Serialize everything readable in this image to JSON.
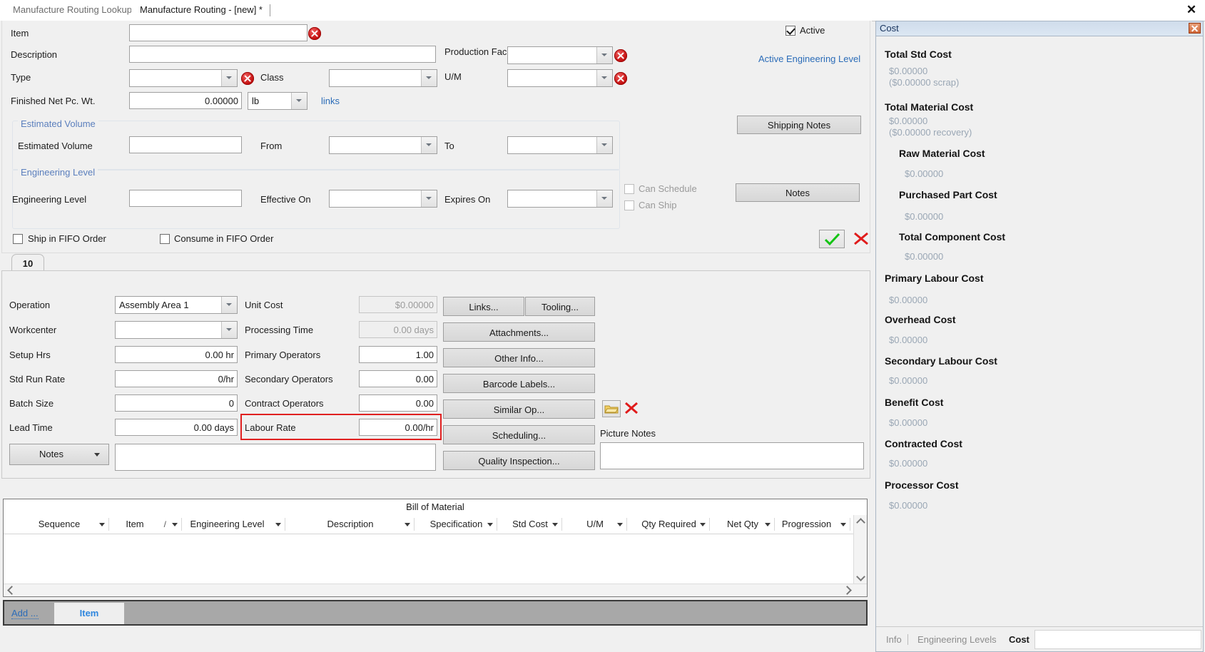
{
  "window": {
    "close_label": "✕"
  },
  "tabs": {
    "inactive": "Manufacture Routing Lookup",
    "active": "Manufacture Routing - [new] *"
  },
  "header": {
    "item_label": "Item",
    "item_value": "",
    "description_label": "Description",
    "description_value": "",
    "type_label": "Type",
    "type_value": "",
    "class_label": "Class",
    "class_value": "",
    "finished_net_label": "Finished Net Pc. Wt.",
    "finished_net_value": "0.00000",
    "uom_weight_value": "lb",
    "links_label": "links",
    "production_facility_label": "Production Facility",
    "production_facility_value": "",
    "um_label": "U/M",
    "um_value": "",
    "active_label": "Active",
    "active_engineering_level_label": "Active Engineering Level",
    "shipping_notes_label": "Shipping Notes",
    "notes_label": "Notes"
  },
  "estimated_volume": {
    "group_title": "Estimated Volume",
    "field_label": "Estimated Volume",
    "field_value": "",
    "from_label": "From",
    "from_value": "",
    "to_label": "To",
    "to_value": ""
  },
  "engineering_level": {
    "group_title": "Engineering Level",
    "field_label": "Engineering Level",
    "field_value": "",
    "effective_on_label": "Effective On",
    "effective_on_value": "",
    "expires_on_label": "Expires On",
    "expires_on_value": "",
    "can_schedule_label": "Can Schedule",
    "can_ship_label": "Can Ship"
  },
  "fifo": {
    "ship_label": "Ship in FIFO Order",
    "consume_label": "Consume in FIFO Order"
  },
  "operation": {
    "tab_label": "10",
    "operation_label": "Operation",
    "operation_value": "Assembly Area 1",
    "workcenter_label": "Workcenter",
    "workcenter_value": "",
    "setup_hrs_label": "Setup Hrs",
    "setup_hrs_value": "0.00 hr",
    "std_run_rate_label": "Std Run Rate",
    "std_run_rate_value": "0/hr",
    "batch_size_label": "Batch Size",
    "batch_size_value": "0",
    "lead_time_label": "Lead Time",
    "lead_time_value": "0.00 days",
    "unit_cost_label": "Unit Cost",
    "unit_cost_value": "$0.00000",
    "processing_time_label": "Processing Time",
    "processing_time_value": "0.00 days",
    "primary_operators_label": "Primary Operators",
    "primary_operators_value": "1.00",
    "secondary_operators_label": "Secondary Operators",
    "secondary_operators_value": "0.00",
    "contract_operators_label": "Contract Operators",
    "contract_operators_value": "0.00",
    "labour_rate_label": "Labour Rate",
    "labour_rate_value": "0.00/hr",
    "notes_label": "Notes",
    "notes_value": "",
    "picture_notes_label": "Picture Notes",
    "picture_notes_value": "",
    "buttons": {
      "links": "Links...",
      "tooling": "Tooling...",
      "attachments": "Attachments...",
      "other_info": "Other Info...",
      "barcode_labels": "Barcode Labels...",
      "similar_op": "Similar Op...",
      "scheduling": "Scheduling...",
      "quality_inspection": "Quality Inspection..."
    }
  },
  "bom": {
    "title": "Bill of Material",
    "columns": [
      "Sequence",
      "Item",
      "Engineering Level",
      "Description",
      "Specification",
      "Std Cost",
      "U/M",
      "Qty Required",
      "Net Qty",
      "Progression"
    ],
    "rows": []
  },
  "statusbar": {
    "add_label": "Add ...",
    "item_label": "Item"
  },
  "cost": {
    "panel_title": "Cost",
    "entries": [
      {
        "title": "Total Std Cost",
        "value": "$0.00000",
        "extra": "($0.00000 scrap)",
        "indent": 0
      },
      {
        "title": "Total Material Cost",
        "value": "$0.00000",
        "extra": "($0.00000 recovery)",
        "indent": 0
      },
      {
        "title": "Raw Material Cost",
        "value": "$0.00000",
        "extra": "",
        "indent": 1
      },
      {
        "title": "Purchased Part Cost",
        "value": "$0.00000",
        "extra": "",
        "indent": 1
      },
      {
        "title": "Total Component Cost",
        "value": "$0.00000",
        "extra": "",
        "indent": 1
      },
      {
        "title": "Primary Labour Cost",
        "value": "$0.00000",
        "extra": "",
        "indent": 0
      },
      {
        "title": "Overhead Cost",
        "value": "$0.00000",
        "extra": "",
        "indent": 0
      },
      {
        "title": "Secondary Labour Cost",
        "value": "$0.00000",
        "extra": "",
        "indent": 0
      },
      {
        "title": "Benefit Cost",
        "value": "$0.00000",
        "extra": "",
        "indent": 0
      },
      {
        "title": "Contracted Cost",
        "value": "$0.00000",
        "extra": "",
        "indent": 0
      },
      {
        "title": "Processor Cost",
        "value": "$0.00000",
        "extra": "",
        "indent": 0
      }
    ],
    "tabs": [
      {
        "label": "Info",
        "selected": false
      },
      {
        "label": "Engineering Levels",
        "selected": false
      },
      {
        "label": "Cost",
        "selected": true
      }
    ]
  },
  "colors": {
    "accent_link": "#2b6cb8",
    "group_title": "#5b7fbd",
    "error_red": "#c20d0d",
    "highlight_red": "#e02020",
    "cost_value": "#9aa7b5"
  }
}
